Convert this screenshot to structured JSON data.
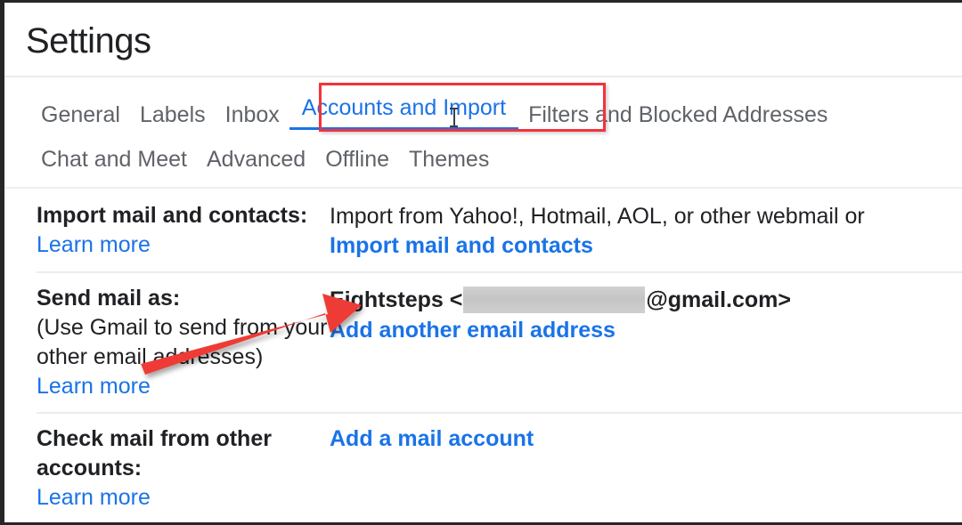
{
  "header": {
    "title": "Settings"
  },
  "tabs": {
    "row1": [
      {
        "label": "General",
        "active": false
      },
      {
        "label": "Labels",
        "active": false
      },
      {
        "label": "Inbox",
        "active": false
      },
      {
        "label": "Accounts and Import",
        "active": true
      },
      {
        "label": "Filters and Blocked Addresses",
        "active": false
      }
    ],
    "row2": [
      {
        "label": "Chat and Meet",
        "active": false
      },
      {
        "label": "Advanced",
        "active": false
      },
      {
        "label": "Offline",
        "active": false
      },
      {
        "label": "Themes",
        "active": false
      }
    ]
  },
  "annotations": {
    "highlight_color": "#f4323c",
    "arrow_color": "#ef3b34",
    "active_tab_underline_color": "#1a73e8"
  },
  "settings_rows": [
    {
      "label": "Import mail and contacts:",
      "label_link": "Learn more",
      "description": "Import from Yahoo!, Hotmail, AOL, or other webmail or",
      "action_link": "Import mail and contacts"
    },
    {
      "label": "Send mail as:",
      "sublabel_line1": "(Use Gmail to send from your",
      "sublabel_line2": "other email addresses)",
      "label_link": "Learn more",
      "account_prefix": "Eightsteps <",
      "account_redacted": "",
      "account_suffix": "@gmail.com>",
      "action_link": "Add another email address"
    },
    {
      "label_line1": "Check mail from other",
      "label_line2": "accounts:",
      "label_link": "Learn more",
      "action_link": "Add a mail account"
    }
  ]
}
